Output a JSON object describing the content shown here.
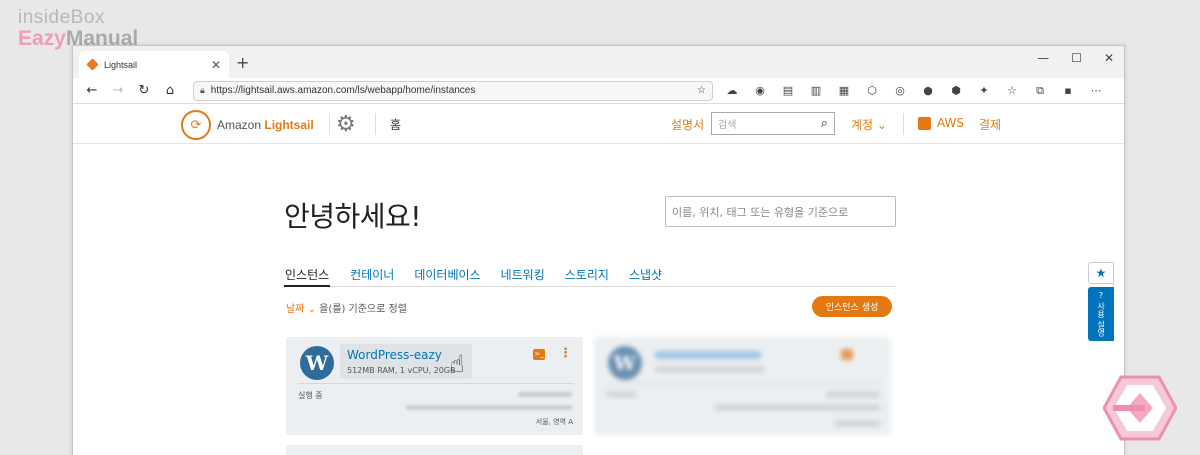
{
  "watermark": {
    "top": "insideBox",
    "bottom_a": "Eazy",
    "bottom_b": "Manual"
  },
  "browser": {
    "tab_title": "Lightsail",
    "tab_close": "✕",
    "new_tab": "+",
    "window_controls": [
      "—",
      "☐",
      "✕"
    ],
    "url": "https://lightsail.aws.amazon.com/ls/webapp/home/instances",
    "nav": {
      "back": "←",
      "forward": "→",
      "reload": "↻",
      "home": "⌂"
    },
    "extension_icons": [
      "☁",
      "◉",
      "▤",
      "▥",
      "▦",
      "⬡",
      "◎",
      "●",
      "⬢",
      "✦",
      "☆",
      "⧉",
      "▪",
      "⋯"
    ]
  },
  "lightsail_nav": {
    "logo_prefix": "Amazon ",
    "logo_brand": "Lightsail",
    "home": "홈",
    "docs": "설명서",
    "search_placeholder": "검색",
    "account": "계정 ⌄",
    "aws": "AWS",
    "billing": "결제"
  },
  "page": {
    "greeting": "안녕하세요!",
    "filter_placeholder": "이름, 위치, 태그 또는 유형을 기준으로",
    "tabs": [
      "인스턴스",
      "컨테이너",
      "데이터베이스",
      "네트워킹",
      "스토리지",
      "스냅샷"
    ],
    "sort_key": "날짜 ⌄",
    "sort_rest": " 을(를) 기준으로 정렬",
    "create_button": "인스턴스 생성"
  },
  "instances": [
    {
      "name": "WordPress-eazy",
      "spec": "512MB RAM, 1 vCPU, 20GB",
      "status": "실행 중",
      "region": "서울, 영역 A"
    }
  ],
  "side_panel": {
    "star": "★",
    "help_icon": "?",
    "help_label": "사용 설명"
  },
  "colors": {
    "accent": "#e47911",
    "link": "#0073bb",
    "card_bg": "#eceff1"
  }
}
